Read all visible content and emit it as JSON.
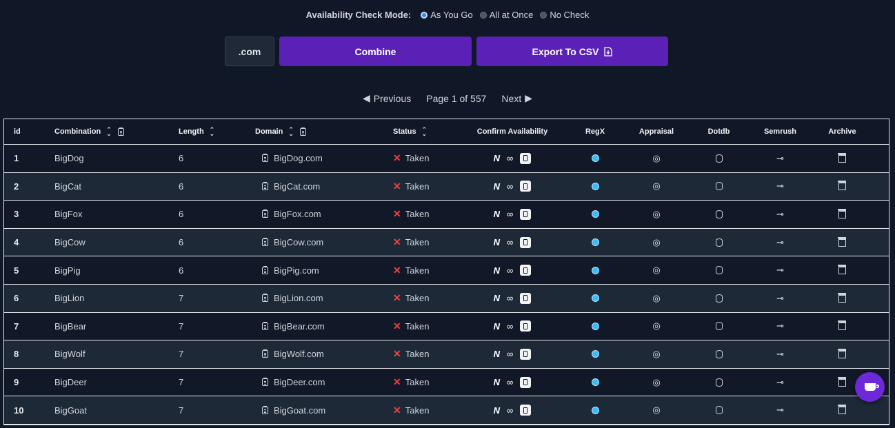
{
  "mode": {
    "label": "Availability Check Mode:",
    "options": [
      {
        "label": "As You Go",
        "selected": true
      },
      {
        "label": "All at Once",
        "selected": false
      },
      {
        "label": "No Check",
        "selected": false
      }
    ]
  },
  "toolbar": {
    "extension": ".com",
    "combine_label": "Combine",
    "export_label": "Export To CSV"
  },
  "pager": {
    "previous": "Previous",
    "page_text": "Page 1 of 557",
    "next": "Next"
  },
  "table": {
    "headers": {
      "id": "id",
      "combination": "Combination",
      "length": "Length",
      "domain": "Domain",
      "status": "Status",
      "confirm": "Confirm Availability",
      "regx": "RegX",
      "appraisal": "Appraisal",
      "dotdb": "Dotdb",
      "semrush": "Semrush",
      "archive": "Archive"
    },
    "rows": [
      {
        "id": "1",
        "combination": "BigDog",
        "length": "6",
        "domain": "BigDog.com",
        "status": "Taken"
      },
      {
        "id": "2",
        "combination": "BigCat",
        "length": "6",
        "domain": "BigCat.com",
        "status": "Taken"
      },
      {
        "id": "3",
        "combination": "BigFox",
        "length": "6",
        "domain": "BigFox.com",
        "status": "Taken"
      },
      {
        "id": "4",
        "combination": "BigCow",
        "length": "6",
        "domain": "BigCow.com",
        "status": "Taken"
      },
      {
        "id": "5",
        "combination": "BigPig",
        "length": "6",
        "domain": "BigPig.com",
        "status": "Taken"
      },
      {
        "id": "6",
        "combination": "BigLion",
        "length": "7",
        "domain": "BigLion.com",
        "status": "Taken"
      },
      {
        "id": "7",
        "combination": "BigBear",
        "length": "7",
        "domain": "BigBear.com",
        "status": "Taken"
      },
      {
        "id": "8",
        "combination": "BigWolf",
        "length": "7",
        "domain": "BigWolf.com",
        "status": "Taken"
      },
      {
        "id": "9",
        "combination": "BigDeer",
        "length": "7",
        "domain": "BigDeer.com",
        "status": "Taken"
      },
      {
        "id": "10",
        "combination": "BigGoat",
        "length": "7",
        "domain": "BigGoat.com",
        "status": "Taken"
      }
    ]
  },
  "colors": {
    "background": "#101828",
    "accent": "#5b21b6",
    "taken": "#ef4444"
  }
}
